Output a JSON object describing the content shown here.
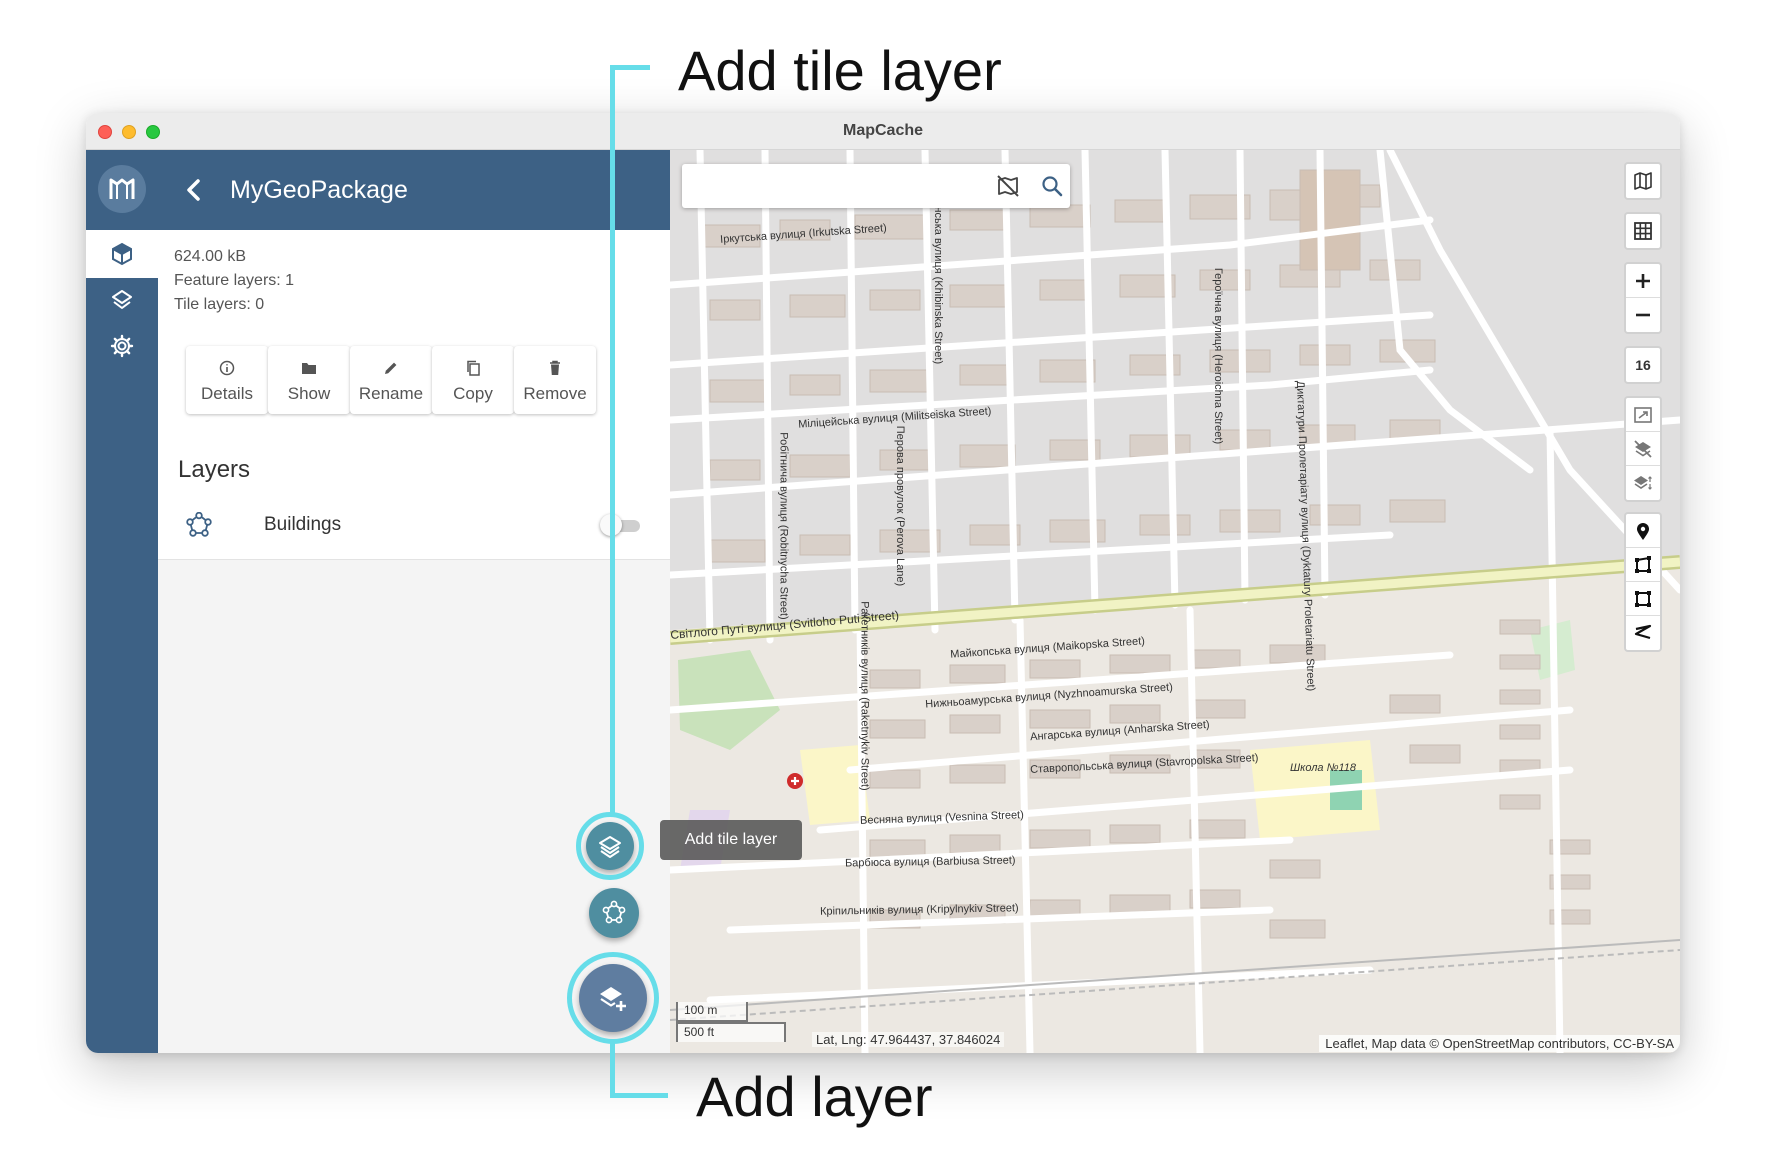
{
  "window": {
    "title": "MapCache"
  },
  "rail": {
    "items": [
      {
        "icon": "geopackage-icon",
        "active": true
      },
      {
        "icon": "layers-icon",
        "active": false
      },
      {
        "icon": "gear-icon",
        "active": false
      }
    ]
  },
  "panel": {
    "title": "MyGeoPackage",
    "size": "624.00 kB",
    "feature_layers": "Feature layers: 1",
    "tile_layers": "Tile layers: 0",
    "actions": [
      {
        "label": "Details",
        "icon": "info-icon"
      },
      {
        "label": "Show",
        "icon": "folder-icon"
      },
      {
        "label": "Rename",
        "icon": "pencil-icon"
      },
      {
        "label": "Copy",
        "icon": "copy-icon"
      },
      {
        "label": "Remove",
        "icon": "trash-icon"
      }
    ],
    "layers_heading": "Layers",
    "layers": [
      {
        "name": "Buildings",
        "icon": "feature-layer-icon",
        "visible": false
      }
    ]
  },
  "fabs": {
    "tooltip": "Add tile layer",
    "add_tile_layer_icon": "layers-icon",
    "add_feature_layer_icon": "polygon-icon",
    "add_layer_icon": "layer-plus-icon"
  },
  "map": {
    "search_placeholder": "",
    "zoom_level": "16",
    "scale_metric": "100 m",
    "scale_imperial": "500 ft",
    "latlng": "Lat, Lng: 47.964437, 37.846024",
    "attribution": "Leaflet, Map data © OpenStreetMap contributors, CC-BY-SA",
    "street_labels": [
      "Іркутська вулиця (Irkutska Street)",
      "Міліцейська вулиця (Militseiska Street)",
      "Світлого Путі вулиця (Svitloho Puti Street)",
      "Майкопська вулиця (Maikopska Street)",
      "Нижньоамурська вулиця (Nyzhnoamurska Street)",
      "Ангарська вулиця (Anharska Street)",
      "Ставропольська вулиця (Stavropolska Street)",
      "Весняна вулиця (Vesnina Street)",
      "Барбюса вулиця (Barbiusa Street)",
      "Кріпильників вулиця (Kripylnykiv Street)",
      "Робітнича вулиця (Robitnycha Street)",
      "Перова провулок (Perova Lane)",
      "Ракетників вулиця (Raketnykiv Street)",
      "Хібінська вулиця (Khibinska Street)",
      "Диктатури Пролетаріату вулиця (Dyktatury Proletariatu Street)",
      "Героїчна вулиця (Heroichna Street)",
      "Школа №118"
    ]
  },
  "callouts": {
    "top": "Add tile layer",
    "bottom": "Add layer",
    "color": "#66dde9"
  },
  "colors": {
    "rail": "#3d6185",
    "fab": "#4f8ea0",
    "fab_main": "#5f7da0",
    "accent": "#66dde9"
  }
}
